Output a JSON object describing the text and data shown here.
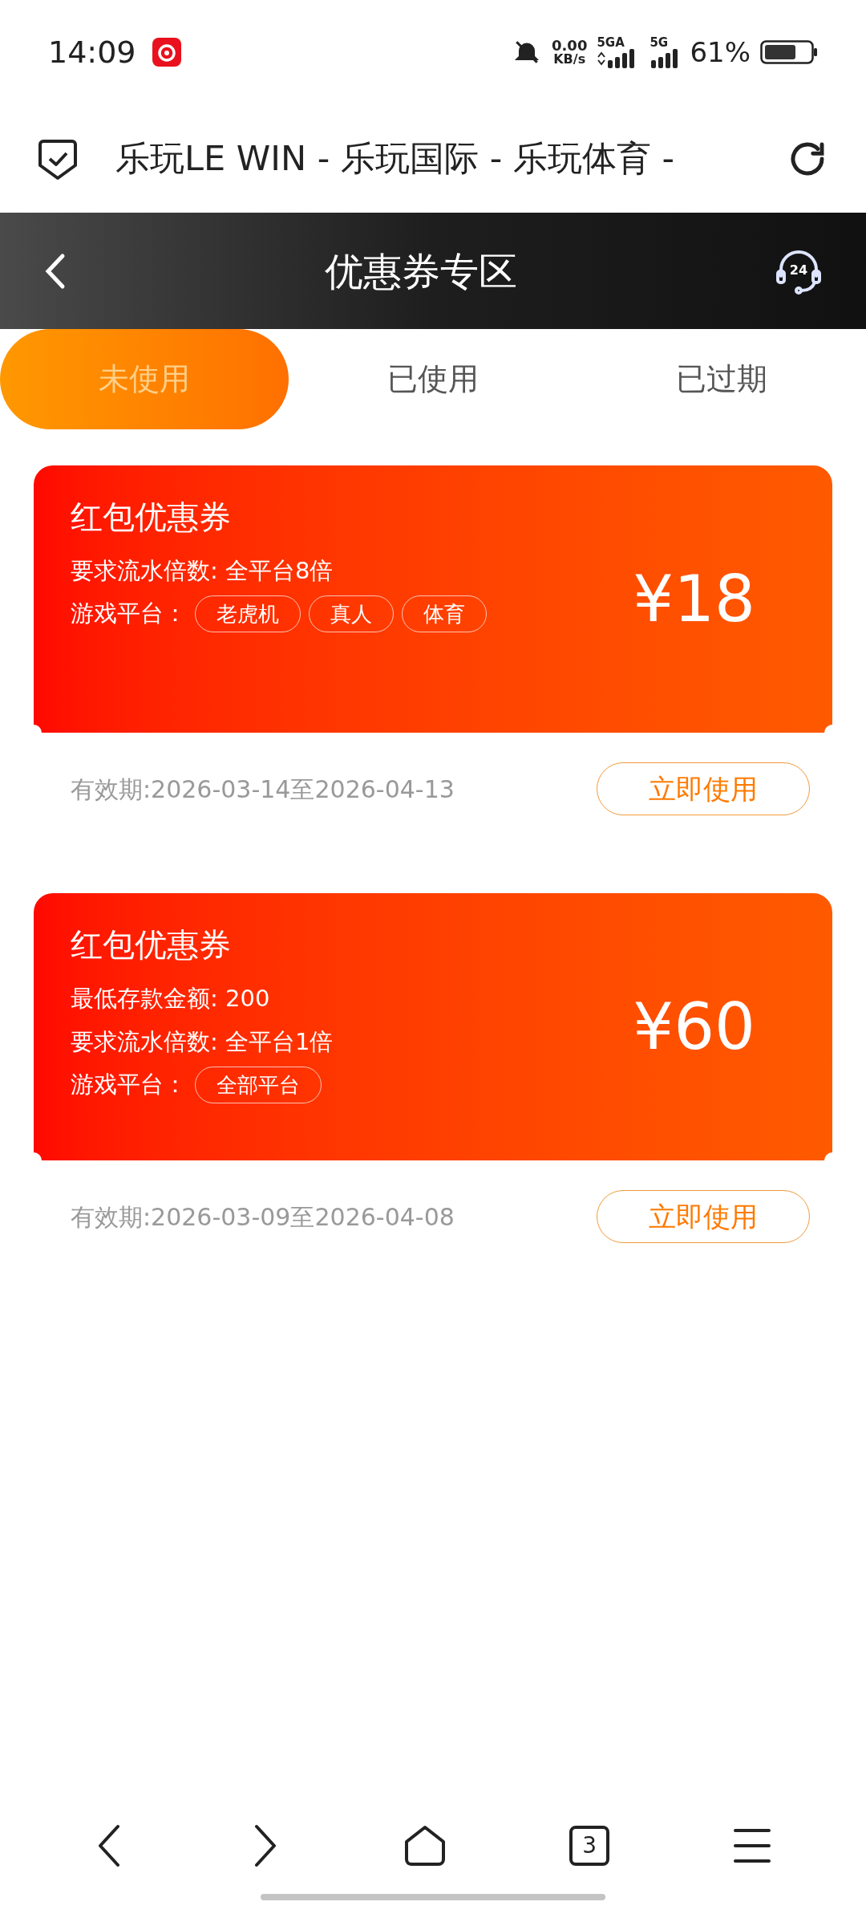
{
  "status_bar": {
    "time": "14:09",
    "net_speed": "0.00",
    "net_unit": "KB/s",
    "signal_1": "5GA",
    "signal_2": "5G",
    "battery": "61%"
  },
  "browser": {
    "title": "乐玩LE WIN - 乐玩国际 - 乐玩体育 -"
  },
  "header": {
    "title": "优惠券专区",
    "support_badge": "24"
  },
  "tabs": [
    {
      "label": "未使用",
      "selected": true
    },
    {
      "label": "已使用",
      "selected": false
    },
    {
      "label": "已过期",
      "selected": false
    }
  ],
  "coupons": [
    {
      "title": "红包优惠券",
      "lines": [
        "要求流水倍数: 全平台8倍"
      ],
      "platform_label": "游戏平台：",
      "platforms": [
        "老虎机",
        "真人",
        "体育"
      ],
      "amount": "¥18",
      "validity": "有效期:2026-03-14至2026-04-13",
      "button": "立即使用"
    },
    {
      "title": "红包优惠券",
      "lines": [
        "最低存款金额: 200",
        "要求流水倍数: 全平台1倍"
      ],
      "platform_label": "游戏平台：",
      "platforms": [
        "全部平台"
      ],
      "amount": "¥60",
      "validity": "有效期:2026-03-09至2026-04-08",
      "button": "立即使用"
    }
  ],
  "bottom_nav": {
    "tab_count": "3"
  }
}
